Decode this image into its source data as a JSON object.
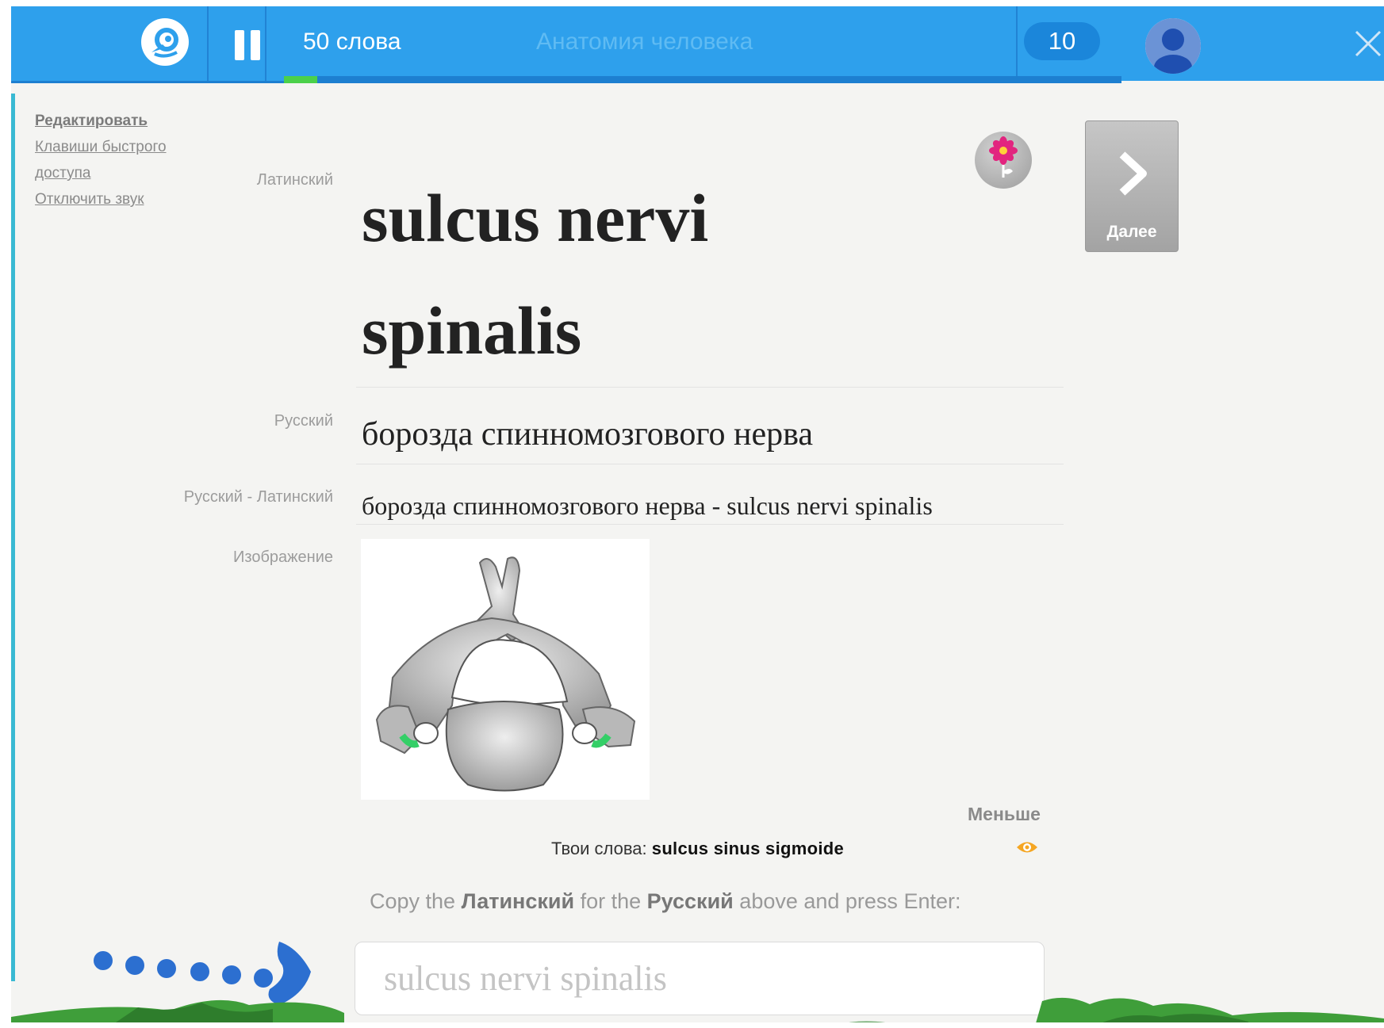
{
  "topbar": {
    "logo_icon": "watering-can-icon",
    "pause_icon": "pause-icon",
    "words_label": "50 слова",
    "course_title": "Анатомия человека",
    "score": "10",
    "progress_fraction": 0.04,
    "avatar_icon": "user-avatar-icon",
    "close_icon": "close-icon",
    "colors": {
      "bar": "#2ea0ec",
      "progress": "#4bd04a"
    }
  },
  "sidebar": {
    "links": [
      "Редактировать",
      "Клавиши быстрого доступа",
      "Отключить звук"
    ]
  },
  "card": {
    "labels": {
      "latin": "Латинский",
      "russian": "Русский",
      "pair": "Русский - Латинский",
      "image": "Изображение"
    },
    "latin_word": "sulcus nervi spinalis",
    "russian_word": "борозда спинномозгового нерва",
    "pair_text": "борозда спинномозгового нерва - sulcus nervi spinalis",
    "image_icon": "vertebra-image"
  },
  "actions": {
    "flower_icon": "flower-icon",
    "next_icon": "chevron-right-icon",
    "next_label": "Далее",
    "less_label": "Меньше"
  },
  "your_words": {
    "prefix": "Твои слова:",
    "word": "sulcus sinus sigmoide",
    "eye_icon": "eye-icon"
  },
  "prompt": {
    "part1": "Copy the",
    "bold1": "Латинский",
    "part2": "for the",
    "bold2": "Русский",
    "part3": "above and press Enter:"
  },
  "answer": {
    "placeholder": "sulcus nervi spinalis"
  }
}
